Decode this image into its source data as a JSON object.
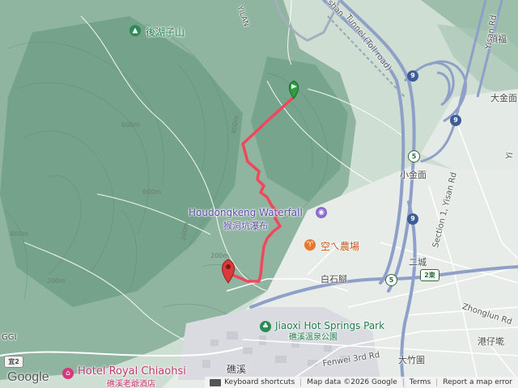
{
  "map": {
    "pois": {
      "houhu": "後湖子山",
      "waterfall_en": "Houdongkeng Waterfall",
      "waterfall_zh": "猴洞坑瀑布",
      "farm": "空ㄟ農場",
      "park_en": "Jiaoxi Hot Springs Park",
      "park_zh": "礁溪溫泉公園",
      "hotel_en": "Hotel Royal Chiaohsi",
      "hotel_zh": "礁溪老爺酒店"
    },
    "places": {
      "dingfu": "頂福",
      "dajinmian": "大金面",
      "xiaojinmian": "小金面",
      "ercheng": "二城",
      "baishijiao": "白石腳",
      "jiaoxi": "礁溪",
      "gangzaidi": "港仔墘",
      "dazhuwei": "大竹圍",
      "yilan_partial": "YILAN",
      "gigi_partial": "GGI"
    },
    "roads": {
      "tunnel": "Tunnel (Toll road)",
      "tunnel_prefix": "shan",
      "yisan": "Yisan Rd",
      "section1": "Section 1, Yisan Rd",
      "zhonglun": "Zhonglun Rd",
      "fenwei": "Fenwei 3rd Rd",
      "yi_partial": "Yi"
    },
    "shields": {
      "route9a": "9",
      "route9b": "9",
      "route9c": "9",
      "route5a": "5",
      "route5b": "5",
      "route2e": "2東",
      "yi2": "宜2"
    },
    "contours": [
      "600m",
      "600m",
      "400m",
      "400m",
      "200m",
      "200m",
      "200m"
    ],
    "brand": "Google",
    "footer": {
      "shortcuts": "Keyboard shortcuts",
      "data": "Map data ©2026 Google",
      "terms": "Terms",
      "report": "Report a map error"
    },
    "colors": {
      "trail": "#f0485a",
      "highway": "#8ea0c8",
      "start_marker": "#2e9d3f",
      "end_marker": "#d93a3a"
    },
    "icons": {
      "houhu": "mountain-peak-icon",
      "waterfall": "camera-icon",
      "farm": "restaurant-icon",
      "park": "tree-icon",
      "hotel": "hotel-icon",
      "start": "start-flag-marker-icon",
      "end": "end-pin-marker-icon"
    }
  }
}
